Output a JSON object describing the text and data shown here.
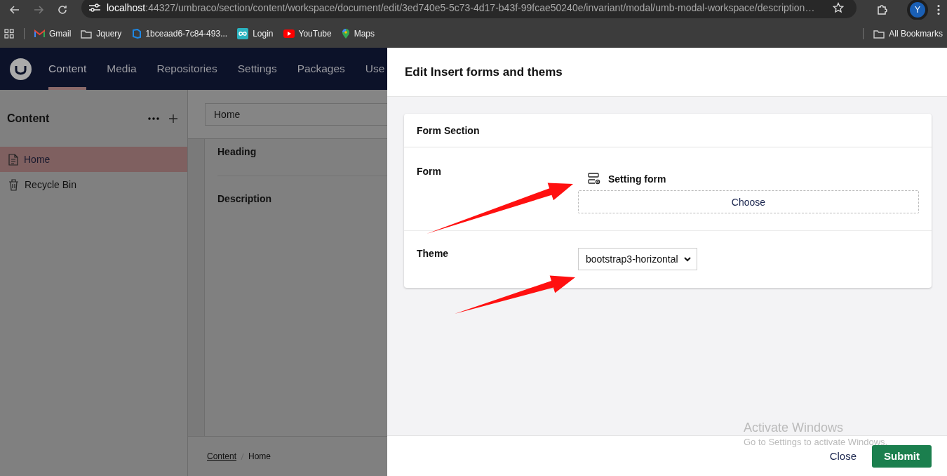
{
  "browser": {
    "url": {
      "host": "localhost",
      "path": ":44327/umbraco/section/content/workspace/document/edit/3ed740e5-5c73-4d17-b43f-99fcae50240e/invariant/modal/umb-modal-workspace/description…"
    },
    "bookmarks": [
      {
        "kind": "gmail",
        "label": "Gmail"
      },
      {
        "kind": "folder",
        "label": "Jquery"
      },
      {
        "kind": "azure",
        "label": "1bceaad6-7c84-493..."
      },
      {
        "kind": "login",
        "label": "Login"
      },
      {
        "kind": "youtube",
        "label": "YouTube"
      },
      {
        "kind": "maps",
        "label": "Maps"
      }
    ],
    "all_bookmarks": "All Bookmarks",
    "profile_initial": "Y"
  },
  "header": {
    "sections": [
      {
        "label": "Content",
        "selected": true
      },
      {
        "label": "Media",
        "selected": false
      },
      {
        "label": "Repositories",
        "selected": false
      },
      {
        "label": "Settings",
        "selected": false
      },
      {
        "label": "Packages",
        "selected": false
      },
      {
        "label": "Use",
        "selected": false
      }
    ]
  },
  "sidebar": {
    "title": "Content",
    "items": [
      {
        "kind": "document",
        "label": "Home",
        "selected": true
      },
      {
        "kind": "trash",
        "label": "Recycle Bin",
        "selected": false
      }
    ]
  },
  "editor": {
    "name_value": "Home",
    "properties": [
      "Heading",
      "Description"
    ],
    "breadcrumbs": [
      {
        "label": "Content",
        "link": true
      },
      {
        "label": "Home",
        "link": false
      }
    ]
  },
  "modal": {
    "title": "Edit Insert forms and thems",
    "section_title": "Form Section",
    "form": {
      "label": "Form",
      "picked": "Setting form",
      "choose_button": "Choose"
    },
    "theme": {
      "label": "Theme",
      "value": "bootstrap3-horizontal"
    },
    "buttons": {
      "close": "Close",
      "submit": "Submit"
    }
  },
  "os_notice": {
    "title": "Activate Windows",
    "subtitle": "Go to Settings to activate Windows."
  }
}
